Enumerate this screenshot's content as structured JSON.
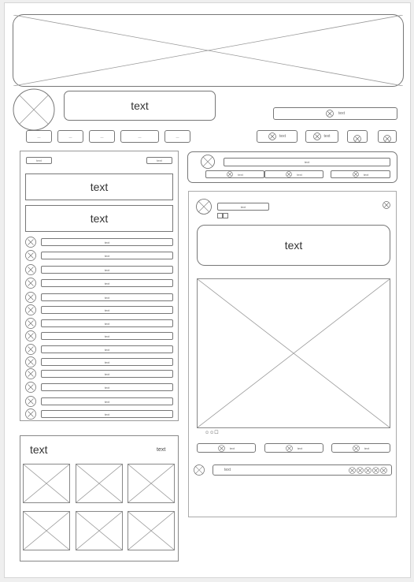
{
  "banner": {
    "image": "banner-placeholder"
  },
  "profile": {
    "title": "text",
    "search_text": "text",
    "nav_items": [
      "—",
      "—",
      "—",
      "—",
      "—"
    ],
    "action_buttons": [
      "text",
      "text"
    ]
  },
  "left_panel": {
    "header_left": "text",
    "header_right": "text",
    "blocks": [
      "text",
      "text"
    ],
    "list": [
      "text",
      "text",
      "text",
      "text",
      "text",
      "text",
      "text",
      "text",
      "text",
      "text",
      "text",
      "text",
      "text",
      "text"
    ]
  },
  "gallery": {
    "title": "text",
    "link": "text"
  },
  "composer": {
    "input_text": "text",
    "actions": [
      "text",
      "text",
      "text"
    ]
  },
  "post": {
    "author": "text",
    "body": "text",
    "reactions": "☺☺☐",
    "actions": [
      "text",
      "text",
      "text"
    ],
    "comment_text": "text"
  },
  "colors": {
    "border": "#777777",
    "placeholder": "#999999",
    "page": "#ffffff",
    "background": "#efefef"
  }
}
